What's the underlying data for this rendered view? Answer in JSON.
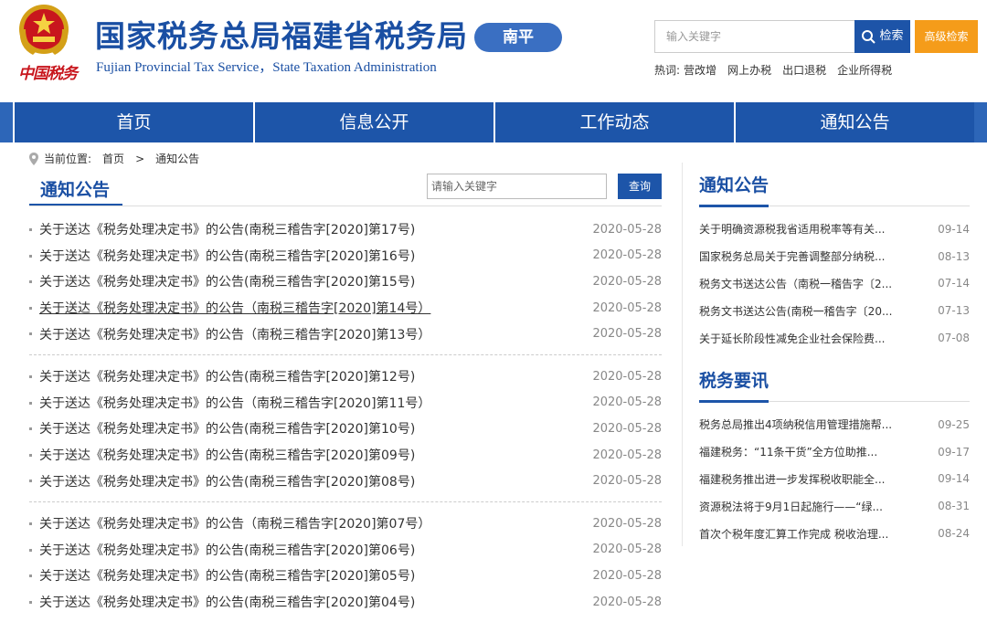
{
  "header": {
    "title_cn": "国家税务总局福建省税务局",
    "title_en": "Fujian Provincial Tax Service，State Taxation Administration",
    "city": "南平",
    "brand_script": "中国税务",
    "search_placeholder": "输入关键字",
    "search_button": "检索",
    "advanced_button": "高级检索",
    "hot_label": "热词:",
    "hot_words": [
      "营改增",
      "网上办税",
      "出口退税",
      "企业所得税"
    ]
  },
  "nav": [
    "首页",
    "信息公开",
    "工作动态",
    "通知公告"
  ],
  "breadcrumb": {
    "label": "当前位置:",
    "items": [
      "首页",
      "通知公告"
    ],
    "separator": ">"
  },
  "main": {
    "title": "通知公告",
    "search_placeholder": "请输入关键字",
    "search_button": "查询",
    "groups": [
      [
        {
          "title": "关于送达《税务处理决定书》的公告(南税三稽告字[2020]第17号)",
          "date": "2020-05-28"
        },
        {
          "title": "关于送达《税务处理决定书》的公告(南税三稽告字[2020]第16号)",
          "date": "2020-05-28"
        },
        {
          "title": "关于送达《税务处理决定书》的公告(南税三稽告字[2020]第15号)",
          "date": "2020-05-28"
        },
        {
          "title": "关于送达《税务处理决定书》的公告（南税三稽告字[2020]第14号）",
          "date": "2020-05-28",
          "hover": true
        },
        {
          "title": "关于送达《税务处理决定书》的公告（南税三稽告字[2020]第13号）",
          "date": "2020-05-28"
        }
      ],
      [
        {
          "title": "关于送达《税务处理决定书》的公告(南税三稽告字[2020]第12号)",
          "date": "2020-05-28"
        },
        {
          "title": "关于送达《税务处理决定书》的公告（南税三稽告字[2020]第11号）",
          "date": "2020-05-28"
        },
        {
          "title": "关于送达《税务处理决定书》的公告(南税三稽告字[2020]第10号)",
          "date": "2020-05-28"
        },
        {
          "title": "关于送达《税务处理决定书》的公告(南税三稽告字[2020]第09号)",
          "date": "2020-05-28"
        },
        {
          "title": "关于送达《税务处理决定书》的公告(南税三稽告字[2020]第08号)",
          "date": "2020-05-28"
        }
      ],
      [
        {
          "title": "关于送达《税务处理决定书》的公告（南税三稽告字[2020]第07号）",
          "date": "2020-05-28"
        },
        {
          "title": "关于送达《税务处理决定书》的公告(南税三稽告字[2020]第06号)",
          "date": "2020-05-28"
        },
        {
          "title": "关于送达《税务处理决定书》的公告(南税三稽告字[2020]第05号)",
          "date": "2020-05-28"
        },
        {
          "title": "关于送达《税务处理决定书》的公告(南税三稽告字[2020]第04号)",
          "date": "2020-05-28"
        }
      ]
    ]
  },
  "sidebar": {
    "notices_title": "通知公告",
    "notices": [
      {
        "title": "关于明确资源税我省适用税率等有关...",
        "date": "09-14"
      },
      {
        "title": "国家税务总局关于完善调整部分纳税...",
        "date": "08-13"
      },
      {
        "title": "税务文书送达公告（南税一稽告字〔2...",
        "date": "07-14"
      },
      {
        "title": "税务文书送达公告(南税一稽告字〔20...",
        "date": "07-13"
      },
      {
        "title": "关于延长阶段性减免企业社会保险费...",
        "date": "07-08"
      }
    ],
    "news_title": "税务要讯",
    "news": [
      {
        "title": "税务总局推出4项纳税信用管理措施帮...",
        "date": "09-25"
      },
      {
        "title": "福建税务：“11条干货”全方位助推...",
        "date": "09-17"
      },
      {
        "title": "福建税务推出进一步发挥税收职能全...",
        "date": "09-14"
      },
      {
        "title": "资源税法将于9月1日起施行——“绿...",
        "date": "08-31"
      },
      {
        "title": "首次个税年度汇算工作完成 税收治理...",
        "date": "08-24"
      }
    ]
  },
  "colors": {
    "primary": "#1d55a9",
    "accent": "#f59c1a",
    "brand_red": "#c8161d"
  }
}
